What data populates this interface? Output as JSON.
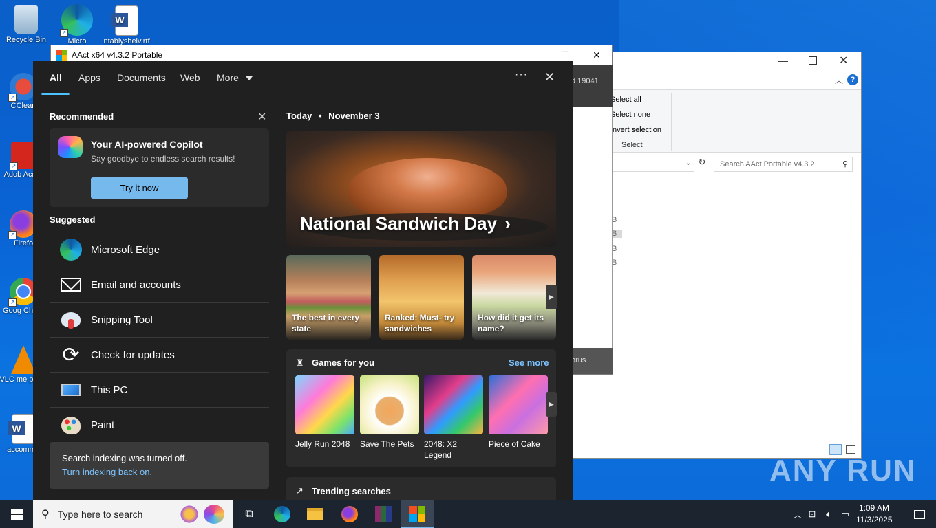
{
  "desktop": {
    "icons": [
      {
        "label": "Recycle Bin"
      },
      {
        "label": "CClean"
      },
      {
        "label": "Adob Acrob"
      },
      {
        "label": "Firefo"
      },
      {
        "label": "Goog Chron"
      },
      {
        "label": "VLC me playe"
      },
      {
        "label": "accommu"
      }
    ],
    "top_icon_labels": [
      "Micro",
      "ntablysheiv.rtf"
    ]
  },
  "aact_window": {
    "title": "AAct x64 v4.3.2 Portable",
    "side_text_1": "d 19041",
    "side_text_2": "orus"
  },
  "explorer_window": {
    "select_all": "Select all",
    "select_none": "Select none",
    "invert_selection": "Invert selection",
    "group_label": "Select",
    "search_placeholder": "Search AAct Portable v4.3.2",
    "b_letter": "B"
  },
  "search_panel": {
    "tabs": [
      "All",
      "Apps",
      "Documents",
      "Web",
      "More"
    ],
    "more_icon": "ellipsis-icon",
    "recommended_title": "Recommended",
    "copilot": {
      "title": "Your AI-powered Copilot",
      "subtitle": "Say goodbye to endless search results!",
      "button": "Try it now"
    },
    "suggested_title": "Suggested",
    "suggested": [
      {
        "label": "Microsoft Edge",
        "icon": "edge-icon"
      },
      {
        "label": "Email and accounts",
        "icon": "mail-icon"
      },
      {
        "label": "Snipping Tool",
        "icon": "snipping-tool-icon"
      },
      {
        "label": "Check for updates",
        "icon": "refresh-icon"
      },
      {
        "label": "This PC",
        "icon": "computer-icon"
      },
      {
        "label": "Paint",
        "icon": "paint-icon"
      }
    ],
    "notice": {
      "text": "Search indexing was turned off.",
      "link": "Turn indexing back on."
    },
    "today": {
      "label": "Today",
      "dot": "•",
      "date": "November 3"
    },
    "hero_title": "National Sandwich Day",
    "hero_chevron": "›",
    "tiles": [
      {
        "caption": "The best in every state"
      },
      {
        "caption": "Ranked: Must- try sandwiches"
      },
      {
        "caption": "How did it get its name?"
      }
    ],
    "games": {
      "title": "Games for you",
      "see_more": "See more",
      "items": [
        {
          "name": "Jelly Run 2048"
        },
        {
          "name": "Save The Pets"
        },
        {
          "name": "2048: X2 Legend"
        },
        {
          "name": "Piece of Cake"
        }
      ]
    },
    "trending_title": "Trending searches"
  },
  "taskbar": {
    "search_placeholder": "Type here to search",
    "time": "1:09 AM",
    "date": "11/3/2025"
  },
  "watermark": "ANY RUN"
}
